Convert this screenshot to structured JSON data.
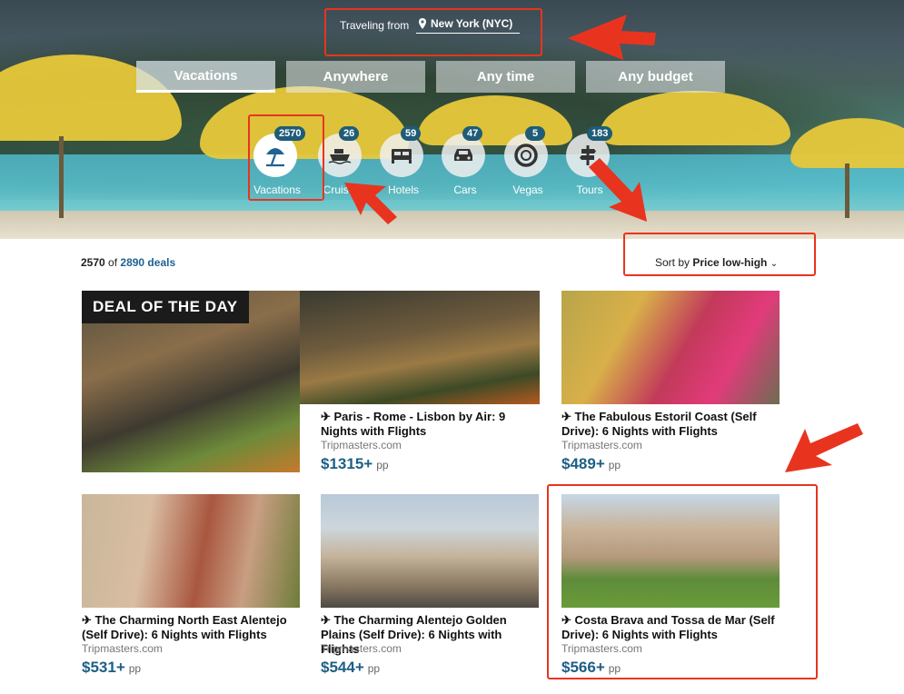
{
  "hero": {
    "traveling_from_label": "Traveling from",
    "traveling_from_value": "New York (NYC)",
    "tabs": [
      {
        "label": "Vacations",
        "active": true
      },
      {
        "label": "Anywhere",
        "active": false
      },
      {
        "label": "Any time",
        "active": false
      },
      {
        "label": "Any budget",
        "active": false
      }
    ],
    "categories": [
      {
        "label": "Vacations",
        "count": "2570",
        "icon": "beach-umbrella-icon",
        "active": true
      },
      {
        "label": "Cruises",
        "count": "26",
        "icon": "ship-icon",
        "active": false
      },
      {
        "label": "Hotels",
        "count": "59",
        "icon": "bed-icon",
        "active": false
      },
      {
        "label": "Cars",
        "count": "47",
        "icon": "car-icon",
        "active": false
      },
      {
        "label": "Vegas",
        "count": "5",
        "icon": "casino-chip-icon",
        "active": false
      },
      {
        "label": "Tours",
        "count": "183",
        "icon": "signpost-icon",
        "active": false
      }
    ]
  },
  "results": {
    "shown": "2570",
    "of": "of",
    "total": "2890 deals",
    "sort_prefix": "Sort by",
    "sort_value": "Price low-high"
  },
  "deal_of_the_day": "DEAL OF THE DAY",
  "cards": [
    {
      "title": "✈ Paris - Rome - Lisbon by Air: 9 Nights with Flights",
      "site": "Tripmasters.com",
      "price": "$1315+",
      "pp": "pp"
    },
    {
      "title": "✈ The Fabulous Estoril Coast (Self Drive): 6 Nights with Flights",
      "site": "Tripmasters.com",
      "price": "$489+",
      "pp": "pp"
    },
    {
      "title": "✈ The Charming North East Alentejo (Self Drive): 6 Nights with Flights",
      "site": "Tripmasters.com",
      "price": "$531+",
      "pp": "pp"
    },
    {
      "title": "✈ The Charming Alentejo Golden Plains (Self Drive): 6 Nights with Flights",
      "site": "Tripmasters.com",
      "price": "$544+",
      "pp": "pp"
    },
    {
      "title": "✈ Costa Brava and Tossa de Mar (Self Drive): 6 Nights with Flights",
      "site": "Tripmasters.com",
      "price": "$566+",
      "pp": "pp"
    }
  ],
  "colors": {
    "accent": "#1d5f85",
    "badge": "#1f5c78",
    "annotation": "#e8341f"
  }
}
